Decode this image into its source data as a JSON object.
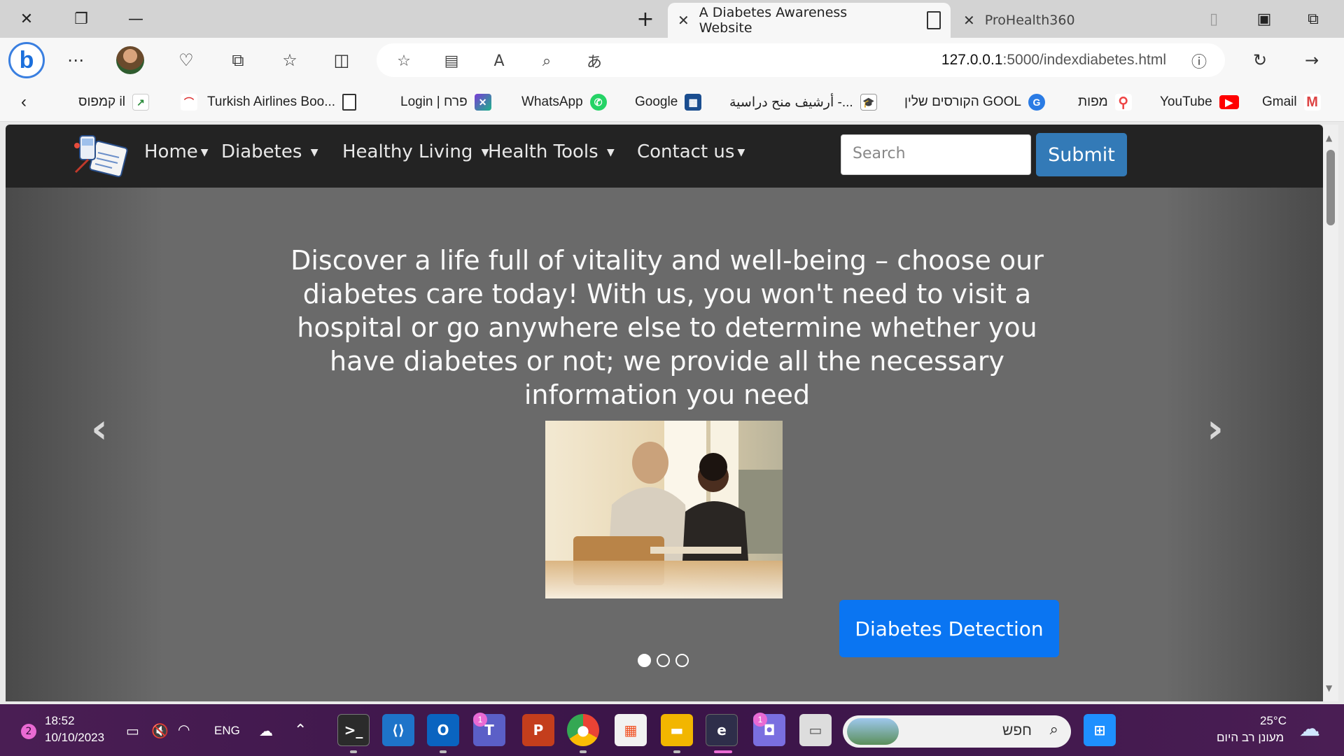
{
  "browser": {
    "tabs": [
      {
        "title": "A Diabetes Awareness Website",
        "active": true
      },
      {
        "title": "ProHealth360",
        "active": false
      }
    ],
    "url_host": "127.0.0.1",
    "url_path": ":5000/indexdiabetes.html",
    "favorites": [
      {
        "label": "Gmail",
        "icon": "gmail-icon"
      },
      {
        "label": "YouTube",
        "icon": "youtube-icon"
      },
      {
        "label": "מפות",
        "icon": "maps-icon"
      },
      {
        "label": "הקורסים שלין GOOL",
        "icon": "gool-icon"
      },
      {
        "label": "أرشيف منح دراسية -...",
        "icon": "grad-cap-icon"
      },
      {
        "label": "Google",
        "icon": "google-icon"
      },
      {
        "label": "WhatsApp",
        "icon": "whatsapp-icon"
      },
      {
        "label": "Login | פרח",
        "icon": "perach-icon"
      },
      {
        "label": "Turkish Airlines Boo...",
        "icon": "page-icon"
      },
      {
        "label": "קמפוס il",
        "icon": "campus-icon"
      }
    ]
  },
  "site": {
    "nav": [
      {
        "label": "Home"
      },
      {
        "label": "Diabetes"
      },
      {
        "label": "Healthy Living"
      },
      {
        "label": "Health Tools"
      },
      {
        "label": "Contact us"
      }
    ],
    "search_placeholder": "Search",
    "submit_label": "Submit",
    "hero_text": "Discover a life full of vitality and well-being – choose our diabetes care today! With us, you won't need to visit a hospital or go anywhere else to determine whether you have diabetes or not; we provide all the necessary information you need",
    "cta_label": "Diabetes Detection",
    "slide_count": 3,
    "active_slide": 1,
    "prev_arrow": "‹",
    "next_arrow": "›"
  },
  "taskbar": {
    "notification_count": "2",
    "time": "18:52",
    "date": "10/10/2023",
    "language": "ENG",
    "search_text": "חפש",
    "weather_temp": "25°C",
    "weather_desc": "מעונן רב היום",
    "teams_badge": "1",
    "chat_badge": "1"
  },
  "colors": {
    "navbar": "#232323",
    "submit": "#337ab7",
    "cta": "#0a75f2",
    "carousel": "#6a6a6a"
  }
}
